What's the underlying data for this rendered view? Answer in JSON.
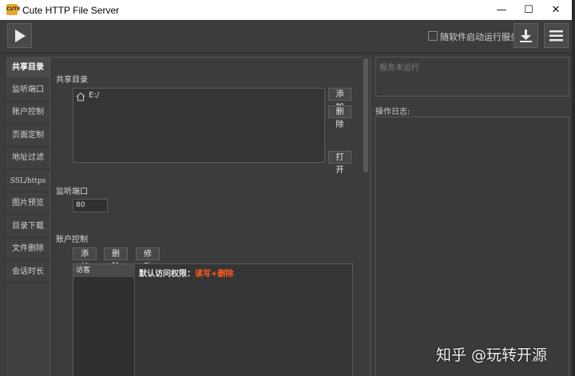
{
  "window": {
    "title": "Cute HTTP File Server",
    "app_icon_text": "CUTE",
    "minimize_glyph": "—",
    "maximize_glyph": "☐",
    "close_glyph": "✕"
  },
  "toolbar": {
    "play_icon": "play-icon",
    "autostart_label": "随软件启动运行服务",
    "autostart_checked": false,
    "download_icon": "download-icon",
    "menu_icon": "hamburger-menu-icon"
  },
  "tabs": [
    {
      "label": "共享目录",
      "active": true
    },
    {
      "label": "监听端口",
      "active": false
    },
    {
      "label": "账户控制",
      "active": false
    },
    {
      "label": "页面定制",
      "active": false
    },
    {
      "label": "地址过滤",
      "active": false
    },
    {
      "label": "SSL/https",
      "active": false
    },
    {
      "label": "图片预览",
      "active": false
    },
    {
      "label": "目录下载",
      "active": false
    },
    {
      "label": "文件删除",
      "active": false
    },
    {
      "label": "会话时长",
      "active": false
    }
  ],
  "shared_dir": {
    "title": "共享目录",
    "entries": [
      {
        "icon": "home-icon",
        "path": "E:/"
      }
    ],
    "add_label": "添加",
    "delete_label": "删除",
    "open_label": "打开"
  },
  "listen_port": {
    "title": "监听端口",
    "value": "80"
  },
  "accounts": {
    "title": "账户控制",
    "add_label": "添加",
    "delete_label": "删除",
    "edit_label": "修改",
    "users": [
      "访客"
    ],
    "perm_prefix": "默认访问权限：",
    "perm_value": "读写+删除",
    "perm_color": "#ff5a1f"
  },
  "status": {
    "text": "服务未运行"
  },
  "log": {
    "label": "操作日志:"
  },
  "watermark": {
    "text": "知乎 @玩转开源"
  },
  "colors": {
    "background": "#3c3c3c",
    "titlebar": "#ffffff",
    "accent_warning": "#ff5a1f"
  }
}
